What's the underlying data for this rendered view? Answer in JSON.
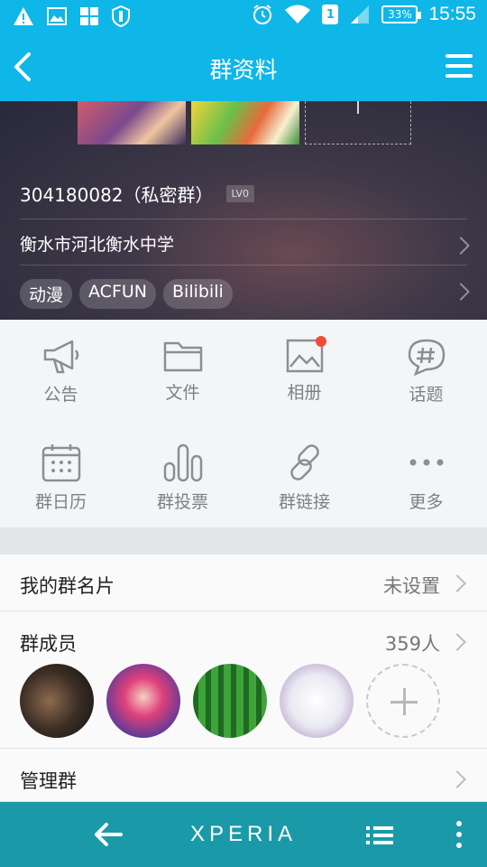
{
  "status_bar": {
    "sim_label": "1",
    "battery": "33%",
    "time": "15:55",
    "icons": [
      "warning-icon",
      "image-icon",
      "grid-icon",
      "shield-icon",
      "alarm-icon",
      "wifi-icon",
      "signal-icon"
    ]
  },
  "title_bar": {
    "title": "群资料",
    "icons": [
      "back-arrow-icon",
      "menu-icon"
    ]
  },
  "header": {
    "group_id": "304180082（私密群）",
    "level": "LV0",
    "location": "衡水市河北衡水中学",
    "tags": [
      "动漫",
      "ACFUN",
      "Bilibili"
    ]
  },
  "functions": [
    {
      "label": "公告",
      "icon": "megaphone-icon"
    },
    {
      "label": "文件",
      "icon": "folder-icon"
    },
    {
      "label": "相册",
      "icon": "photo-album-icon",
      "badge": true
    },
    {
      "label": "话题",
      "icon": "topic-icon"
    },
    {
      "label": "群日历",
      "icon": "calendar-icon"
    },
    {
      "label": "群投票",
      "icon": "vote-icon"
    },
    {
      "label": "群链接",
      "icon": "link-icon"
    },
    {
      "label": "更多",
      "icon": "more-icon"
    }
  ],
  "list": {
    "card_label": "我的群名片",
    "card_value": "未设置",
    "members_label": "群成员",
    "members_value": "359人",
    "manage_label": "管理群"
  },
  "nav_bar": {
    "brand": "XPERIA"
  },
  "colors": {
    "accent": "#0fb6e8",
    "nav": "#1a9aa8",
    "badge": "#f24b39"
  }
}
